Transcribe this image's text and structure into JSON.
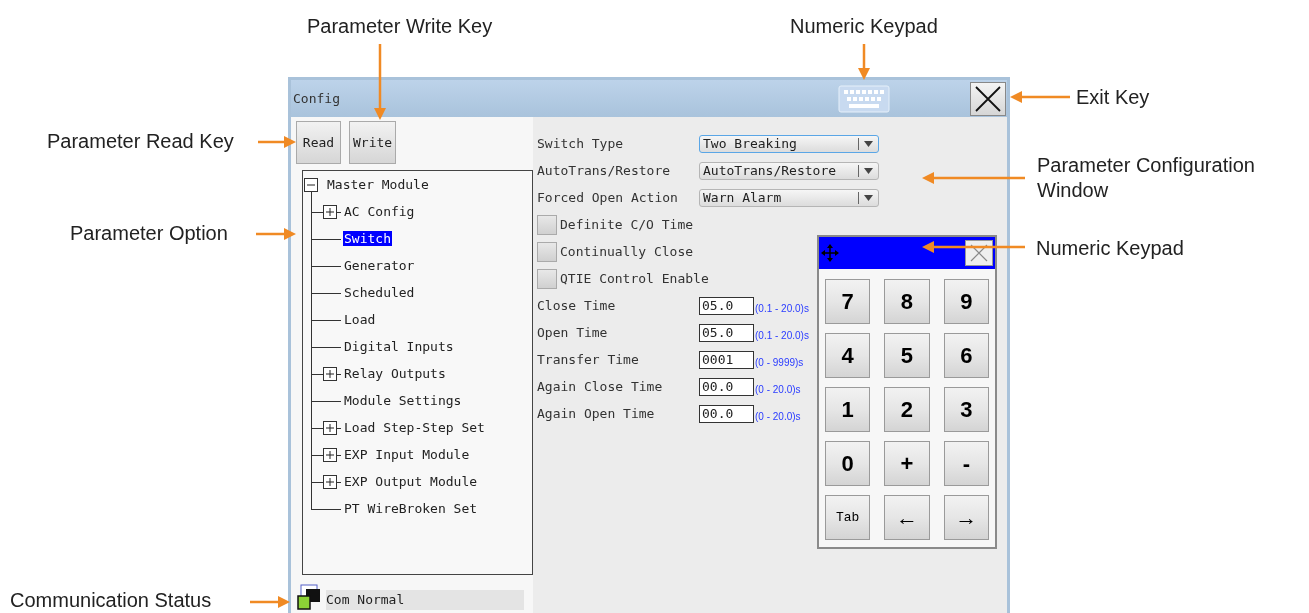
{
  "callouts": [
    {
      "text": "Parameter Write Key"
    },
    {
      "text": "Numeric Keypad"
    },
    {
      "text": "Exit Key"
    },
    {
      "text": "Parameter Read Key"
    },
    {
      "text": "Parameter Configuration Window"
    },
    {
      "text": "Parameter Option"
    },
    {
      "text": "Numeric Keypad"
    },
    {
      "text": "Communication Status"
    }
  ],
  "window": {
    "title": "Config"
  },
  "toolbar_buttons": [
    "Read",
    "Write"
  ],
  "tree": {
    "label": "Master Module",
    "kind": "group",
    "expanded": true,
    "selected": false,
    "children": [
      {
        "label": "AC Config",
        "kind": "group",
        "expanded": false,
        "selected": false
      },
      {
        "label": "Switch",
        "kind": "leaf",
        "selected": true
      },
      {
        "label": "Generator",
        "kind": "leaf",
        "selected": false
      },
      {
        "label": "Scheduled",
        "kind": "leaf",
        "selected": false
      },
      {
        "label": "Load",
        "kind": "leaf",
        "selected": false
      },
      {
        "label": "Digital Inputs",
        "kind": "leaf",
        "selected": false
      },
      {
        "label": "Relay Outputs",
        "kind": "group",
        "expanded": false,
        "selected": false
      },
      {
        "label": "Module Settings",
        "kind": "leaf",
        "selected": false
      },
      {
        "label": "Load Step-Step Set",
        "kind": "group",
        "expanded": false,
        "selected": false
      },
      {
        "label": "EXP Input Module",
        "kind": "group",
        "expanded": false,
        "selected": false
      },
      {
        "label": "EXP Output Module",
        "kind": "group",
        "expanded": false,
        "selected": false
      },
      {
        "label": "PT WireBroken Set",
        "kind": "leaf",
        "selected": false
      }
    ]
  },
  "settings": [
    {
      "kind": "dropdown",
      "label": "Switch Type",
      "value": "Two Breaking",
      "focused": true
    },
    {
      "kind": "dropdown",
      "label": "AutoTrans/Restore",
      "value": "AutoTrans/Restore",
      "focused": false
    },
    {
      "kind": "dropdown",
      "label": "Forced Open Action",
      "value": "Warn Alarm",
      "focused": false
    },
    {
      "kind": "checkbox",
      "label": "Definite C/O Time",
      "checked": false
    },
    {
      "kind": "checkbox",
      "label": "Continually Close",
      "checked": false
    },
    {
      "kind": "checkbox",
      "label": "QTIE Control Enable",
      "checked": false
    },
    {
      "kind": "number",
      "label": "Close Time",
      "value": "05.0",
      "range": "(0.1 - 20.0)s"
    },
    {
      "kind": "number",
      "label": "Open Time",
      "value": "05.0",
      "range": "(0.1 - 20.0)s"
    },
    {
      "kind": "number",
      "label": "Transfer Time",
      "value": "0001",
      "range": "(0 - 9999)s"
    },
    {
      "kind": "number",
      "label": "Again Close Time",
      "value": "00.0",
      "range": "(0 - 20.0)s"
    },
    {
      "kind": "number",
      "label": "Again Open Time",
      "value": "00.0",
      "range": "(0 - 20.0)s"
    }
  ],
  "numeric_keypad": {
    "keys": [
      {
        "label": "7",
        "kind": "big"
      },
      {
        "label": "8",
        "kind": "big"
      },
      {
        "label": "9",
        "kind": "big"
      },
      {
        "label": "4",
        "kind": "big"
      },
      {
        "label": "5",
        "kind": "big"
      },
      {
        "label": "6",
        "kind": "big"
      },
      {
        "label": "1",
        "kind": "big"
      },
      {
        "label": "2",
        "kind": "big"
      },
      {
        "label": "3",
        "kind": "big"
      },
      {
        "label": "0",
        "kind": "big"
      },
      {
        "label": "+",
        "kind": "big"
      },
      {
        "label": "-",
        "kind": "big"
      },
      {
        "label": "Tab",
        "kind": "small"
      },
      {
        "label": "←",
        "kind": "big"
      },
      {
        "label": "→",
        "kind": "big"
      }
    ]
  },
  "status": {
    "text": "Com Normal"
  }
}
